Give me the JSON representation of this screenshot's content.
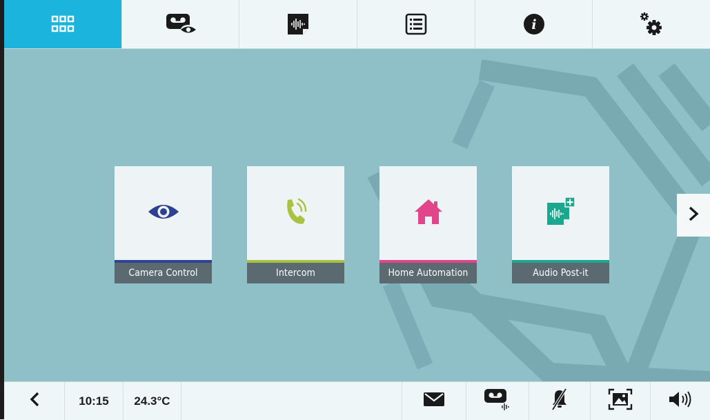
{
  "topbar": {
    "tabs": [
      {
        "icon": "apps-grid-icon",
        "active": true
      },
      {
        "icon": "video-memo-icon",
        "active": false
      },
      {
        "icon": "audio-post-it-icon",
        "active": false
      },
      {
        "icon": "list-icon",
        "active": false
      },
      {
        "icon": "info-icon",
        "active": false
      },
      {
        "icon": "settings-icon",
        "active": false
      }
    ],
    "active_color": "#1ab4dc"
  },
  "main": {
    "tiles": [
      {
        "label": "Camera Control",
        "icon": "eye-icon",
        "accent": "#2d4192"
      },
      {
        "label": "Intercom",
        "icon": "phone-ringing-icon",
        "accent": "#a9c23f"
      },
      {
        "label": "Home Automation",
        "icon": "home-icon",
        "accent": "#e2458b"
      },
      {
        "label": "Audio Post-it",
        "icon": "audio-post-it-add-icon",
        "accent": "#1aa78e"
      }
    ],
    "next_icon": "chevron-right-icon"
  },
  "bottombar": {
    "back_icon": "chevron-left-icon",
    "time": "10:15",
    "temperature": "24.3°C",
    "icons": [
      "mail-icon",
      "audio-memo-icon",
      "bell-muted-icon",
      "picture-icon",
      "volume-icon"
    ]
  }
}
